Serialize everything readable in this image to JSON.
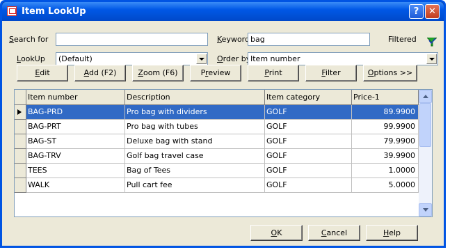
{
  "window": {
    "title": "Item LookUp"
  },
  "search": {
    "search_label": "Search for",
    "search_value": "",
    "keyword_label": "Keyword",
    "keyword_value": "bag",
    "filtered_label": "Filtered",
    "lookup_label": "LookUp",
    "lookup_value": "(Default)",
    "orderby_label": "Order by",
    "orderby_value": "Item number"
  },
  "toolbar": {
    "edit": "Edit",
    "add": "Add (F2)",
    "zoom": "Zoom (F6)",
    "preview": "Preview",
    "print": "Print",
    "filter": "Filter",
    "options": "Options >>"
  },
  "grid": {
    "columns": [
      "Item number",
      "Description",
      "Item category",
      "Price-1"
    ],
    "rows": [
      {
        "item": "BAG-PRD",
        "desc": "Pro bag with dividers",
        "cat": "GOLF",
        "price": "89.9900"
      },
      {
        "item": "BAG-PRT",
        "desc": "Pro bag with tubes",
        "cat": "GOLF",
        "price": "99.9900"
      },
      {
        "item": "BAG-ST",
        "desc": "Deluxe bag with stand",
        "cat": "GOLF",
        "price": "79.9900"
      },
      {
        "item": "BAG-TRV",
        "desc": "Golf bag travel case",
        "cat": "GOLF",
        "price": "39.9900"
      },
      {
        "item": "TEES",
        "desc": "Bag of Tees",
        "cat": "GOLF",
        "price": "1.0000"
      },
      {
        "item": "WALK",
        "desc": "Pull cart fee",
        "cat": "GOLF",
        "price": "5.0000"
      }
    ]
  },
  "footer": {
    "ok": "OK",
    "cancel": "Cancel",
    "help": "Help"
  },
  "colors": {
    "selection": "#316AC5",
    "dialog_bg": "#ECE9D8",
    "titlebar": "#0058E6"
  }
}
